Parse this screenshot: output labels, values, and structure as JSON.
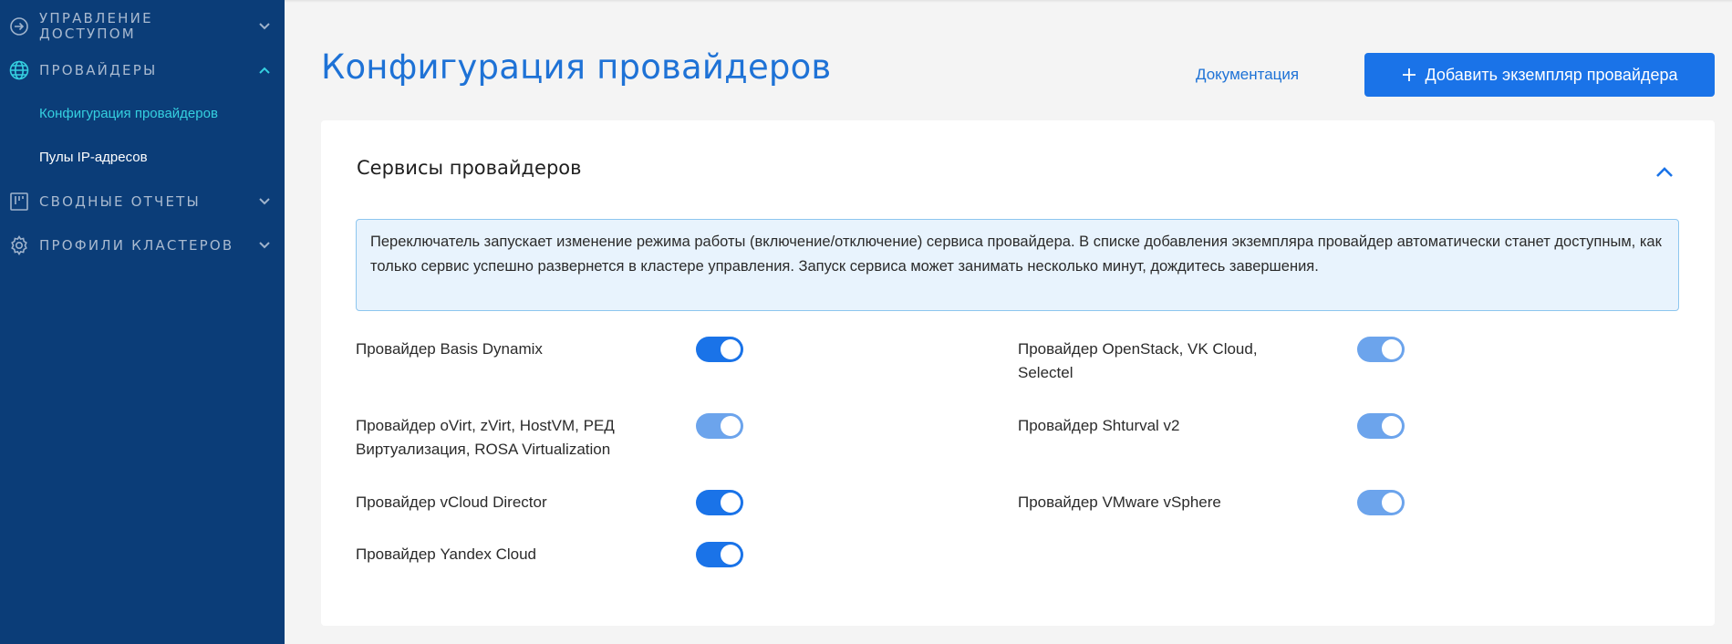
{
  "sidebar": {
    "groups": [
      {
        "label_line1": "Управление",
        "label_line2": "доступом",
        "icon": "sign-in-icon",
        "expanded": false
      },
      {
        "label": "Провайдеры",
        "icon": "globe-icon",
        "expanded": true
      },
      {
        "label": "Сводные отчеты",
        "icon": "kanban-icon",
        "expanded": false
      },
      {
        "label": "Профили кластеров",
        "icon": "gear-icon",
        "expanded": false
      }
    ],
    "sub_items": [
      {
        "label": "Конфигурация провайдеров",
        "active": true
      },
      {
        "label": "Пулы IP-адресов",
        "active": false
      }
    ]
  },
  "header": {
    "title": "Конфигурация провайдеров",
    "doc_link": "Документация",
    "add_button": "Добавить экземпляр провайдера"
  },
  "card": {
    "title": "Сервисы провайдеров",
    "info": "Переключатель запускает изменение режима работы (включение/отключение) сервиса провайдера. В списке добавления экземпляра провайдер автоматически станет доступным, как только сервис успешно развернется в кластере управления. Запуск сервиса может занимать несколько минут, дождитесь завершения.",
    "services": [
      {
        "label": "Провайдер Basis Dynamix",
        "enabled": true,
        "muted": false
      },
      {
        "label": "Провайдер OpenStack, VK Cloud, Selectel",
        "enabled": true,
        "muted": true
      },
      {
        "label": "Провайдер oVirt, zVirt, HostVM, РЕД Виртуализация, ROSA Virtualization",
        "enabled": true,
        "muted": true
      },
      {
        "label": "Провайдер Shturval v2",
        "enabled": true,
        "muted": true
      },
      {
        "label": "Провайдер vCloud Director",
        "enabled": true,
        "muted": false
      },
      {
        "label": "Провайдер VMware vSphere",
        "enabled": true,
        "muted": true
      },
      {
        "label": "Провайдер Yandex Cloud",
        "enabled": true,
        "muted": false
      }
    ]
  },
  "colors": {
    "sidebar_bg": "#0b3d78",
    "accent": "#1a73e8",
    "active_nav": "#35d0e0",
    "toggle_muted": "#6ca4ec"
  }
}
